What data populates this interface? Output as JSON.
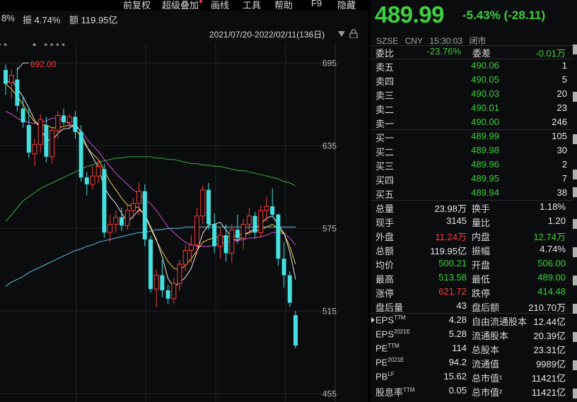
{
  "toolbar": {
    "items": [
      "前复权",
      "超级叠加",
      "画线",
      "工具",
      "帮助",
      "F9",
      "隐藏"
    ]
  },
  "ohlc_bar": {
    "partial": "8%",
    "amplitude": "振 4.74%",
    "amount": "额 119.95亿"
  },
  "range": {
    "text": "2021/07/20-2022/02/11(136日)"
  },
  "colors": {
    "up": "#ff3b3b",
    "down_fill": "#44e0e0",
    "green": "#3fce3f",
    "ma5": "#e8e8e8",
    "ma10": "#f0d040",
    "ma20": "#d050d8",
    "ma60": "#40b040",
    "ma120": "#60c0e0"
  },
  "chart_data": {
    "type": "candlestick",
    "y_ticks": [
      "695",
      "635",
      "575",
      "515",
      "455"
    ],
    "ylim": [
      449,
      710
    ],
    "max_label": "692.00",
    "event_markers": [
      1,
      10,
      45,
      48,
      63,
      73,
      82,
      92
    ],
    "candles": [
      {
        "o": 690,
        "h": 694,
        "l": 672,
        "c": 680
      },
      {
        "o": 681,
        "h": 690,
        "l": 669,
        "c": 686
      },
      {
        "o": 683,
        "h": 692,
        "l": 660,
        "c": 664
      },
      {
        "o": 662,
        "h": 671,
        "l": 648,
        "c": 652
      },
      {
        "o": 650,
        "h": 663,
        "l": 626,
        "c": 630
      },
      {
        "o": 629,
        "h": 640,
        "l": 620,
        "c": 636
      },
      {
        "o": 636,
        "h": 658,
        "l": 630,
        "c": 654
      },
      {
        "o": 650,
        "h": 656,
        "l": 623,
        "c": 627
      },
      {
        "o": 627,
        "h": 648,
        "l": 622,
        "c": 646
      },
      {
        "o": 646,
        "h": 660,
        "l": 640,
        "c": 657
      },
      {
        "o": 657,
        "h": 662,
        "l": 650,
        "c": 652
      },
      {
        "o": 652,
        "h": 658,
        "l": 648,
        "c": 656
      },
      {
        "o": 656,
        "h": 660,
        "l": 640,
        "c": 645
      },
      {
        "o": 645,
        "h": 650,
        "l": 609,
        "c": 612
      },
      {
        "o": 612,
        "h": 616,
        "l": 599,
        "c": 607
      },
      {
        "o": 607,
        "h": 620,
        "l": 603,
        "c": 613
      },
      {
        "o": 613,
        "h": 625,
        "l": 608,
        "c": 620
      },
      {
        "o": 618,
        "h": 622,
        "l": 568,
        "c": 572
      },
      {
        "o": 572,
        "h": 585,
        "l": 565,
        "c": 578
      },
      {
        "o": 578,
        "h": 588,
        "l": 572,
        "c": 583
      },
      {
        "o": 583,
        "h": 590,
        "l": 573,
        "c": 577
      },
      {
        "o": 577,
        "h": 592,
        "l": 574,
        "c": 588
      },
      {
        "o": 588,
        "h": 597,
        "l": 582,
        "c": 593
      },
      {
        "o": 593,
        "h": 608,
        "l": 585,
        "c": 602
      },
      {
        "o": 602,
        "h": 607,
        "l": 562,
        "c": 567
      },
      {
        "o": 567,
        "h": 570,
        "l": 528,
        "c": 531
      },
      {
        "o": 531,
        "h": 545,
        "l": 518,
        "c": 541
      },
      {
        "o": 541,
        "h": 552,
        "l": 525,
        "c": 530
      },
      {
        "o": 530,
        "h": 534,
        "l": 520,
        "c": 524
      },
      {
        "o": 524,
        "h": 539,
        "l": 520,
        "c": 535
      },
      {
        "o": 535,
        "h": 552,
        "l": 530,
        "c": 549
      },
      {
        "o": 549,
        "h": 563,
        "l": 544,
        "c": 559
      },
      {
        "o": 559,
        "h": 570,
        "l": 550,
        "c": 563
      },
      {
        "o": 563,
        "h": 590,
        "l": 556,
        "c": 584
      },
      {
        "o": 584,
        "h": 606,
        "l": 578,
        "c": 603
      },
      {
        "o": 603,
        "h": 608,
        "l": 574,
        "c": 578
      },
      {
        "o": 578,
        "h": 586,
        "l": 557,
        "c": 562
      },
      {
        "o": 562,
        "h": 575,
        "l": 553,
        "c": 570
      },
      {
        "o": 570,
        "h": 578,
        "l": 551,
        "c": 557
      },
      {
        "o": 557,
        "h": 578,
        "l": 550,
        "c": 574
      },
      {
        "o": 574,
        "h": 585,
        "l": 564,
        "c": 568
      },
      {
        "o": 568,
        "h": 582,
        "l": 560,
        "c": 578
      },
      {
        "o": 578,
        "h": 590,
        "l": 570,
        "c": 584
      },
      {
        "o": 584,
        "h": 587,
        "l": 568,
        "c": 572
      },
      {
        "o": 572,
        "h": 592,
        "l": 568,
        "c": 588
      },
      {
        "o": 588,
        "h": 598,
        "l": 580,
        "c": 591
      },
      {
        "o": 591,
        "h": 604,
        "l": 583,
        "c": 585
      },
      {
        "o": 585,
        "h": 586,
        "l": 548,
        "c": 553
      },
      {
        "o": 553,
        "h": 565,
        "l": 532,
        "c": 541
      },
      {
        "o": 541,
        "h": 544,
        "l": 518,
        "c": 521
      },
      {
        "o": 512,
        "h": 515,
        "l": 488,
        "c": 490
      }
    ],
    "ma_lines": {
      "ma10": [
        680,
        676,
        671,
        665,
        658,
        652,
        650,
        650,
        648,
        648,
        649,
        650,
        648,
        641,
        634,
        629,
        625,
        617,
        609,
        603,
        597,
        592,
        591,
        590,
        584,
        575,
        566,
        558,
        551,
        546,
        545,
        548,
        553,
        559,
        565,
        567,
        568,
        569,
        569,
        569,
        570,
        571,
        572,
        573,
        574,
        576,
        578,
        575,
        571,
        562,
        549
      ],
      "ma20": [
        660,
        658,
        655,
        653,
        652,
        651,
        652,
        653,
        655,
        655,
        653,
        651,
        649,
        646,
        640,
        635,
        631,
        625,
        620,
        615,
        611,
        607,
        603,
        600,
        596,
        593,
        588,
        582,
        576,
        572,
        568,
        565,
        563,
        562,
        562,
        562,
        563,
        564,
        565,
        566,
        566,
        567,
        568,
        568,
        569,
        570,
        572,
        572,
        571,
        568,
        563
      ],
      "ma60": [
        580,
        585,
        590,
        595,
        598,
        601,
        604,
        606,
        608,
        610,
        612,
        614,
        616,
        618,
        620,
        621,
        623,
        624,
        625,
        626,
        626,
        627,
        627,
        627,
        627,
        627,
        626,
        626,
        625,
        625,
        624,
        623,
        622,
        622,
        621,
        621,
        620,
        620,
        619,
        618,
        617,
        617,
        616,
        615,
        614,
        613,
        612,
        611,
        609,
        608,
        606
      ],
      "ma120": [
        533,
        536,
        538,
        540,
        543,
        545,
        547,
        549,
        551,
        553,
        555,
        557,
        559,
        560,
        562,
        563,
        565,
        566,
        567,
        568,
        569,
        570,
        571,
        572,
        572,
        573,
        574,
        574,
        575,
        575,
        575,
        576,
        576,
        576,
        576,
        576,
        576,
        576,
        576,
        576,
        576,
        576,
        576,
        576,
        576,
        576,
        576,
        576,
        576,
        576,
        576
      ]
    }
  },
  "quote": {
    "price": "489.99",
    "change": "-5.43% (-28.11)",
    "meta": [
      "SZSE",
      "CNY",
      "15:30:03",
      "闭市"
    ],
    "weibi_label": "委比",
    "weibi_value": "-23.76%",
    "weicha_label": "委差",
    "weicha_value": "-0.01万",
    "asks": [
      {
        "label": "卖五",
        "price": "490.06",
        "vol": "1"
      },
      {
        "label": "卖四",
        "price": "490.05",
        "vol": "5"
      },
      {
        "label": "卖三",
        "price": "490.03",
        "vol": "20"
      },
      {
        "label": "卖二",
        "price": "490.01",
        "vol": "23"
      },
      {
        "label": "卖一",
        "price": "490.00",
        "vol": "246"
      }
    ],
    "bids": [
      {
        "label": "买一",
        "price": "489.99",
        "vol": "105"
      },
      {
        "label": "买二",
        "price": "489.98",
        "vol": "30"
      },
      {
        "label": "买三",
        "price": "489.96",
        "vol": "2"
      },
      {
        "label": "买四",
        "price": "489.95",
        "vol": "7"
      },
      {
        "label": "买五",
        "price": "489.94",
        "vol": "38"
      }
    ],
    "stats": [
      {
        "l1": "总量",
        "v1": "23.98万",
        "c1": "w",
        "l2": "换手",
        "v2": "1.18%",
        "c2": "w"
      },
      {
        "l1": "现手",
        "v1": "3145",
        "c1": "w",
        "l2": "量比",
        "v2": "1.20",
        "c2": "w"
      },
      {
        "l1": "外盘",
        "v1": "11.24万",
        "c1": "r",
        "l2": "内盘",
        "v2": "12.74万",
        "c2": "g"
      },
      {
        "l1": "总额",
        "v1": "119.95亿",
        "c1": "w",
        "l2": "振幅",
        "v2": "4.74%",
        "c2": "w"
      },
      {
        "l1": "均价",
        "v1": "500.21",
        "c1": "g",
        "l2": "开盘",
        "v2": "506.00",
        "c2": "g"
      },
      {
        "l1": "最高",
        "v1": "513.58",
        "c1": "g",
        "l2": "最低",
        "v2": "489.00",
        "c2": "g"
      },
      {
        "l1": "涨停",
        "v1": "621.72",
        "c1": "r",
        "l2": "跌停",
        "v2": "414.48",
        "c2": "g"
      },
      {
        "l1": "盘后量",
        "v1": "43",
        "c1": "w",
        "l2": "盘后额",
        "v2": "210.70万",
        "c2": "w"
      }
    ],
    "fund": [
      {
        "l1": "EPS",
        "s1": "TTM",
        "v1": "4.28",
        "l2": "自由流通股本",
        "v2": "12.44亿"
      },
      {
        "l1": "EPS",
        "s1": "2021E",
        "v1": "5.28",
        "l2": "流通股本",
        "v2": "20.39亿"
      },
      {
        "l1": "PE",
        "s1": "TTM",
        "v1": "114",
        "l2": "总股本",
        "v2": "23.31亿"
      },
      {
        "l1": "PE",
        "s1": "2021E",
        "v1": "94.2",
        "l2": "流通值",
        "v2": "9989亿"
      },
      {
        "l1": "PB",
        "s1": "LF",
        "v1": "15.62",
        "l2": "总市值¹",
        "v2": "11421亿"
      },
      {
        "l1": "股息率",
        "s1": "TTM",
        "v1": "0.05",
        "l2": "总市值²",
        "v2": "11421亿"
      }
    ]
  }
}
